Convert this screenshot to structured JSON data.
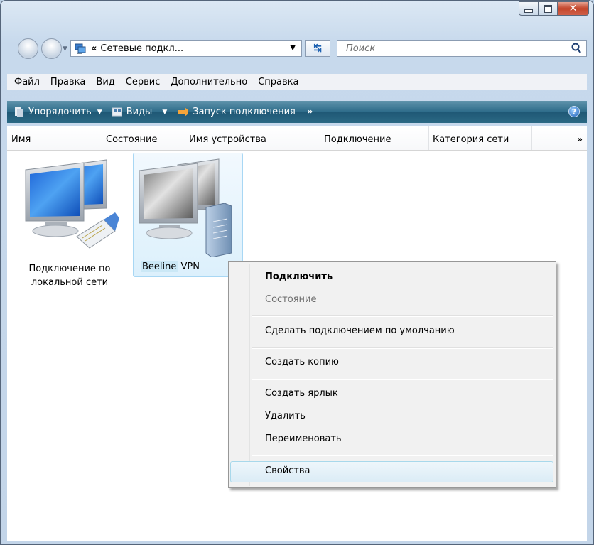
{
  "window": {
    "address_separator": "«",
    "address_path": "Сетевые подкл...",
    "search_placeholder": "Поиск"
  },
  "menubar": [
    "Файл",
    "Правка",
    "Вид",
    "Сервис",
    "Дополнительно",
    "Справка"
  ],
  "toolbar": {
    "organize": "Упорядочить",
    "views": "Виды",
    "start_connection": "Запуск подключения",
    "more": "»",
    "help": "?"
  },
  "columns": [
    "Имя",
    "Состояние",
    "Имя устройства",
    "Подключение",
    "Категория сети"
  ],
  "columns_more": "»",
  "items": [
    {
      "label_line1": "Подключение по",
      "label_line2": "локальной сети"
    },
    {
      "label_part1": "Beeline",
      "label_part2": "VPN"
    }
  ],
  "context_menu": {
    "connect": "Подключить",
    "status": "Состояние",
    "set_default": "Сделать подключением по умолчанию",
    "create_copy": "Создать копию",
    "create_shortcut": "Создать ярлык",
    "delete": "Удалить",
    "rename": "Переименовать",
    "properties": "Свойства"
  },
  "colors": {
    "toolbar": "#2f6d8b",
    "selection": "#dcf0fc",
    "close_button": "#c3452a"
  }
}
